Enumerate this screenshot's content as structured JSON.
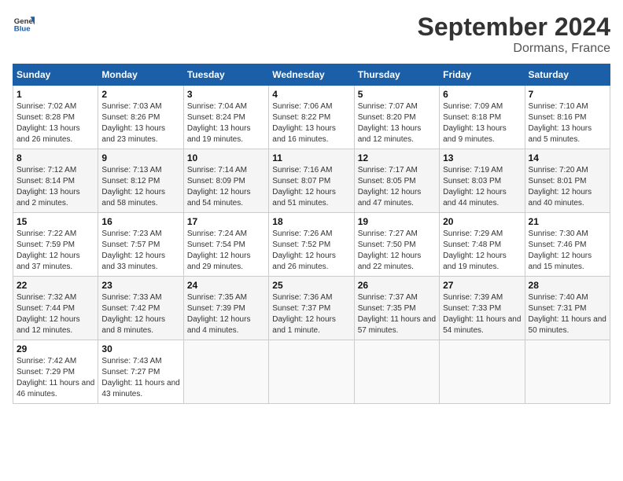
{
  "header": {
    "logo_general": "General",
    "logo_blue": "Blue",
    "month_title": "September 2024",
    "location": "Dormans, France"
  },
  "days_of_week": [
    "Sunday",
    "Monday",
    "Tuesday",
    "Wednesday",
    "Thursday",
    "Friday",
    "Saturday"
  ],
  "weeks": [
    [
      {
        "day": "1",
        "sunrise": "7:02 AM",
        "sunset": "8:28 PM",
        "daylight": "13 hours and 26 minutes."
      },
      {
        "day": "2",
        "sunrise": "7:03 AM",
        "sunset": "8:26 PM",
        "daylight": "13 hours and 23 minutes."
      },
      {
        "day": "3",
        "sunrise": "7:04 AM",
        "sunset": "8:24 PM",
        "daylight": "13 hours and 19 minutes."
      },
      {
        "day": "4",
        "sunrise": "7:06 AM",
        "sunset": "8:22 PM",
        "daylight": "13 hours and 16 minutes."
      },
      {
        "day": "5",
        "sunrise": "7:07 AM",
        "sunset": "8:20 PM",
        "daylight": "13 hours and 12 minutes."
      },
      {
        "day": "6",
        "sunrise": "7:09 AM",
        "sunset": "8:18 PM",
        "daylight": "13 hours and 9 minutes."
      },
      {
        "day": "7",
        "sunrise": "7:10 AM",
        "sunset": "8:16 PM",
        "daylight": "13 hours and 5 minutes."
      }
    ],
    [
      {
        "day": "8",
        "sunrise": "7:12 AM",
        "sunset": "8:14 PM",
        "daylight": "13 hours and 2 minutes."
      },
      {
        "day": "9",
        "sunrise": "7:13 AM",
        "sunset": "8:12 PM",
        "daylight": "12 hours and 58 minutes."
      },
      {
        "day": "10",
        "sunrise": "7:14 AM",
        "sunset": "8:09 PM",
        "daylight": "12 hours and 54 minutes."
      },
      {
        "day": "11",
        "sunrise": "7:16 AM",
        "sunset": "8:07 PM",
        "daylight": "12 hours and 51 minutes."
      },
      {
        "day": "12",
        "sunrise": "7:17 AM",
        "sunset": "8:05 PM",
        "daylight": "12 hours and 47 minutes."
      },
      {
        "day": "13",
        "sunrise": "7:19 AM",
        "sunset": "8:03 PM",
        "daylight": "12 hours and 44 minutes."
      },
      {
        "day": "14",
        "sunrise": "7:20 AM",
        "sunset": "8:01 PM",
        "daylight": "12 hours and 40 minutes."
      }
    ],
    [
      {
        "day": "15",
        "sunrise": "7:22 AM",
        "sunset": "7:59 PM",
        "daylight": "12 hours and 37 minutes."
      },
      {
        "day": "16",
        "sunrise": "7:23 AM",
        "sunset": "7:57 PM",
        "daylight": "12 hours and 33 minutes."
      },
      {
        "day": "17",
        "sunrise": "7:24 AM",
        "sunset": "7:54 PM",
        "daylight": "12 hours and 29 minutes."
      },
      {
        "day": "18",
        "sunrise": "7:26 AM",
        "sunset": "7:52 PM",
        "daylight": "12 hours and 26 minutes."
      },
      {
        "day": "19",
        "sunrise": "7:27 AM",
        "sunset": "7:50 PM",
        "daylight": "12 hours and 22 minutes."
      },
      {
        "day": "20",
        "sunrise": "7:29 AM",
        "sunset": "7:48 PM",
        "daylight": "12 hours and 19 minutes."
      },
      {
        "day": "21",
        "sunrise": "7:30 AM",
        "sunset": "7:46 PM",
        "daylight": "12 hours and 15 minutes."
      }
    ],
    [
      {
        "day": "22",
        "sunrise": "7:32 AM",
        "sunset": "7:44 PM",
        "daylight": "12 hours and 12 minutes."
      },
      {
        "day": "23",
        "sunrise": "7:33 AM",
        "sunset": "7:42 PM",
        "daylight": "12 hours and 8 minutes."
      },
      {
        "day": "24",
        "sunrise": "7:35 AM",
        "sunset": "7:39 PM",
        "daylight": "12 hours and 4 minutes."
      },
      {
        "day": "25",
        "sunrise": "7:36 AM",
        "sunset": "7:37 PM",
        "daylight": "12 hours and 1 minute."
      },
      {
        "day": "26",
        "sunrise": "7:37 AM",
        "sunset": "7:35 PM",
        "daylight": "11 hours and 57 minutes."
      },
      {
        "day": "27",
        "sunrise": "7:39 AM",
        "sunset": "7:33 PM",
        "daylight": "11 hours and 54 minutes."
      },
      {
        "day": "28",
        "sunrise": "7:40 AM",
        "sunset": "7:31 PM",
        "daylight": "11 hours and 50 minutes."
      }
    ],
    [
      {
        "day": "29",
        "sunrise": "7:42 AM",
        "sunset": "7:29 PM",
        "daylight": "11 hours and 46 minutes."
      },
      {
        "day": "30",
        "sunrise": "7:43 AM",
        "sunset": "7:27 PM",
        "daylight": "11 hours and 43 minutes."
      },
      null,
      null,
      null,
      null,
      null
    ]
  ]
}
